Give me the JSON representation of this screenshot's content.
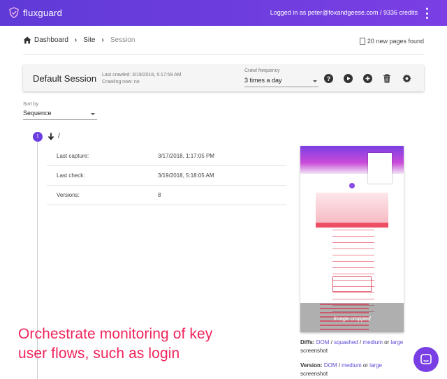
{
  "header": {
    "brand": "fluxguard",
    "user_info": "Logged in as peter@foxandgeese.com / 9336 credits"
  },
  "breadcrumb": {
    "items": [
      "Dashboard",
      "Site",
      "Session"
    ]
  },
  "new_pages": "20 new pages found",
  "session": {
    "title": "Default Session",
    "last_crawled": "Last crawled: 3/19/2018, 5:17:59 AM",
    "crawling_now": "Crawling now: no",
    "freq_label": "Crawl frequency",
    "freq_value": "3 times a day"
  },
  "sort": {
    "label": "Sort by",
    "value": "Sequence"
  },
  "page": {
    "step": "1",
    "path": "/",
    "rows": [
      {
        "key": "Last capture:",
        "value": "3/17/2018, 1:17:05 PM"
      },
      {
        "key": "Last check:",
        "value": "3/19/2018, 5:18:05 AM"
      },
      {
        "key": "Versions:",
        "value": "8"
      }
    ]
  },
  "thumbnail": {
    "overlay_text": "Image cropped"
  },
  "diffs": {
    "label": "Diffs:",
    "dom": "DOM",
    "sep1": " / ",
    "squashed": "squashed",
    "sep2": " / ",
    "medium": "medium",
    "or": " or ",
    "large": "large",
    "suffix": " screenshot"
  },
  "version": {
    "label": "Version:",
    "dom": "DOM",
    "sep1": " / ",
    "medium": "medium",
    "or": " or ",
    "large": "large",
    "suffix": " screenshot"
  },
  "caption": {
    "line1": "Orchestrate monitoring of key",
    "line2": "user flows, such as login"
  },
  "colors": {
    "brand": "#6c3ee0",
    "caption": "#f0245c",
    "link": "#5b4bd6"
  }
}
